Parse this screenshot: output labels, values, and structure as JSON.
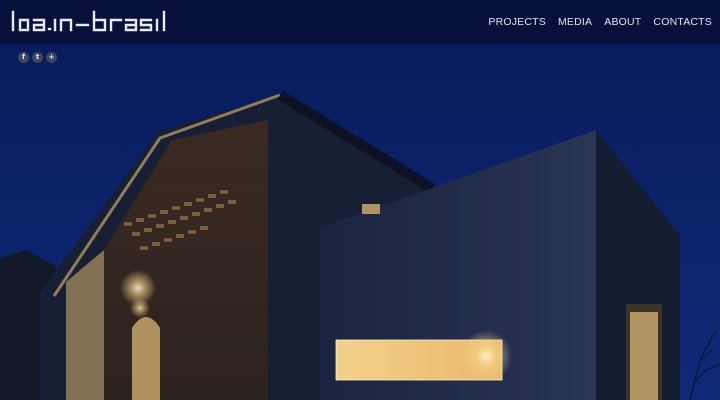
{
  "brand": {
    "name": "lda.in-brasil"
  },
  "nav": {
    "items": [
      "PROJECTS",
      "MEDIA",
      "ABOUT",
      "CONTACTS"
    ]
  },
  "social": {
    "icons": [
      {
        "name": "facebook-icon",
        "glyph": "f"
      },
      {
        "name": "twitter-icon",
        "glyph": "t"
      },
      {
        "name": "plus-icon",
        "glyph": "+"
      }
    ]
  },
  "colors": {
    "sky": "#0b1c56",
    "header": "#07103a",
    "warm_light": "#f6d58a"
  }
}
